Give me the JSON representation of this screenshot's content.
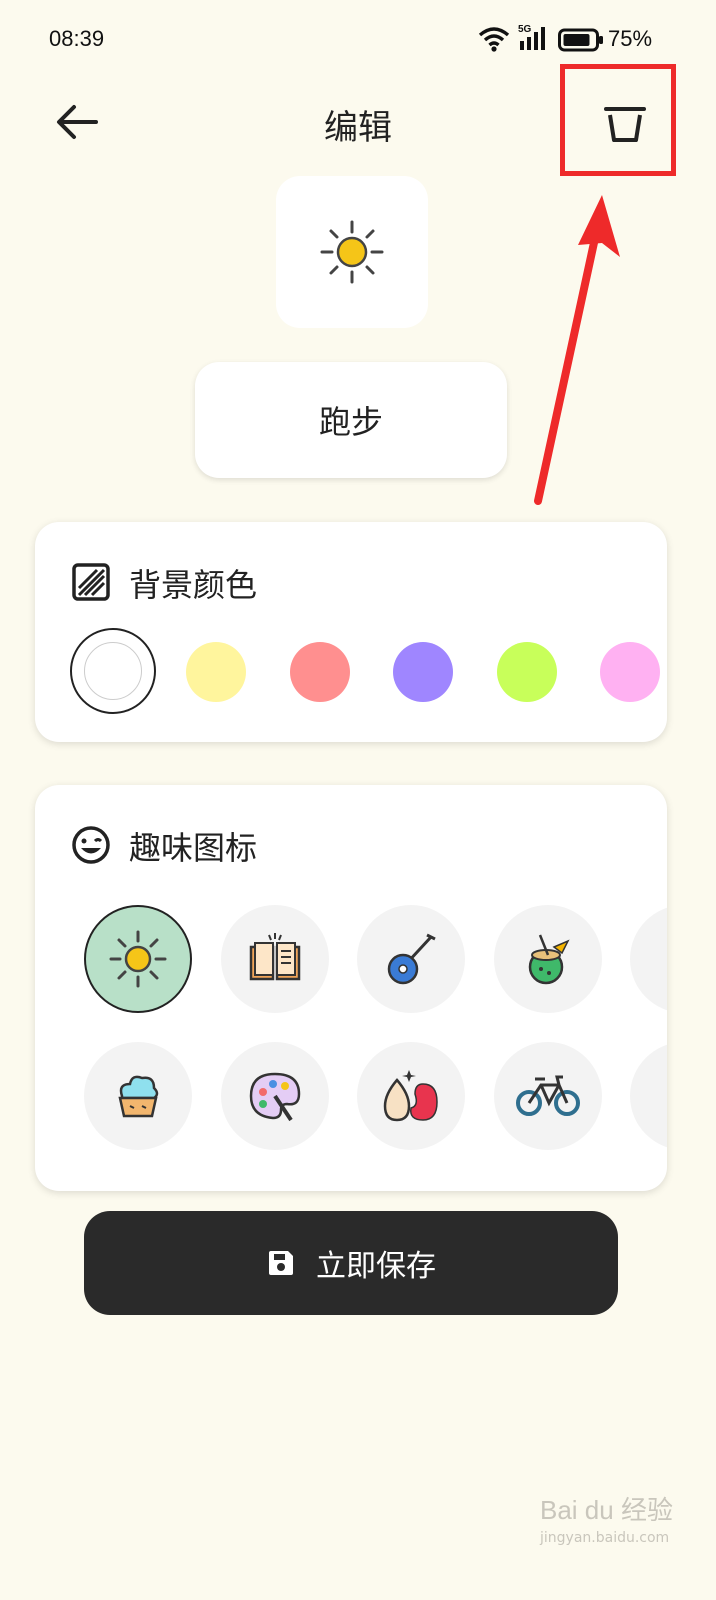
{
  "status_bar": {
    "time": "08:39",
    "signal_label": "5G",
    "battery_pct": "75%"
  },
  "header": {
    "title": "编辑"
  },
  "habit": {
    "name": "跑步"
  },
  "background_color": {
    "title": "背景颜色",
    "swatches": [
      "#ffffff",
      "#fff59d",
      "#ff8f8f",
      "#9f86ff",
      "#c8ff5a",
      "#ffb1f2"
    ],
    "selected_index": 0
  },
  "fun_icons": {
    "title": "趣味图标",
    "selected_index": 0,
    "items": [
      "sun-icon",
      "book-icon",
      "banjo-icon",
      "coconut-drink-icon",
      "more-icon",
      "cupcake-icon",
      "palette-icon",
      "makeup-sponge-icon",
      "bicycle-icon",
      "more-icon"
    ]
  },
  "save_button": {
    "label": "立即保存"
  },
  "annotation": {
    "color": "#ee2a2a"
  },
  "watermark": {
    "brand": "Bai du 经验",
    "url": "jingyan.baidu.com"
  }
}
